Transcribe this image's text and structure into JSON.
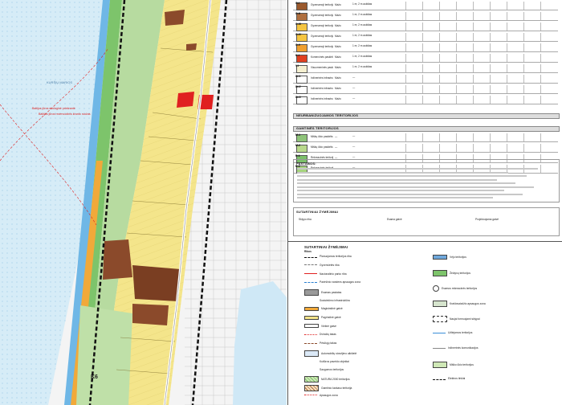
{
  "map": {
    "sea_label": "KURŠIŲ MARIOS",
    "shore_note_1": "Baltijos jūros ekologinė priekrantė",
    "shore_note_2": "Baltijos jūros rezervuotinis kranto ruožas",
    "zone_label": "K6",
    "colors": {
      "sea": "#d6ecf7",
      "dune_green": "#a9d18e",
      "forest": "#d7ebc3",
      "residential": "#f5e98c",
      "commercial": "#8b4a2b",
      "public": "#e02020",
      "beach": "#e8c46a",
      "orange_strip": "#f1a93a",
      "boundary": "#111111"
    }
  },
  "table": {
    "rows": [
      {
        "code": "G-I",
        "color": "#9b5a2e",
        "c1": "Gyvenamoji teritorija",
        "c2": "Mažo",
        "c3": "1 m; 2 m aukštas"
      },
      {
        "code": "G-II",
        "color": "#b07040",
        "c1": "Gyvenamoji teritorija",
        "c2": "Mažo",
        "c3": "1 m; 2 m aukštas"
      },
      {
        "code": "G-III",
        "color": "#f5c542",
        "c1": "Gyvenamoji teritorija",
        "c2": "Mažo",
        "c3": "1 m; 2 m aukštas"
      },
      {
        "code": "G-IV",
        "color": "#f5c542",
        "c1": "Gyvenamoji teritorija",
        "c2": "Mažo",
        "c3": "1 m; 2 m aukštas"
      },
      {
        "code": "G-V",
        "color": "#f0a030",
        "c1": "Gyvenamoji teritorija",
        "c2": "Mažo",
        "c3": "1 m; 2 m aukštas"
      },
      {
        "code": "K-I",
        "color": "#e04020",
        "c1": "Komercinės paskirties",
        "c2": "Mažo",
        "c3": "1 m; 2 m aukštas"
      },
      {
        "code": "V-I",
        "color": "#f5f0d0",
        "c1": "Visuomeninės paskirties",
        "c2": "Mažo",
        "c3": "1 m; 2 m aukštas"
      },
      {
        "code": "IN-1",
        "color": "#ffffff",
        "c1": "Inžinerinės infrastruktūros",
        "c2": "Mažo",
        "c3": "—"
      },
      {
        "code": "IN-2",
        "color": "#ffffff",
        "c1": "Inžinerinės infrastruktūros",
        "c2": "Mažo",
        "c3": "—"
      },
      {
        "code": "IN-3",
        "color": "#ffffff",
        "c1": "Inžinerinės infrastruktūros",
        "c2": "Mažo",
        "c3": "—"
      }
    ],
    "section_2": "NEURBANIZUOJAMOS TERITORIJOS",
    "section_3": "GAMTINĖS TERITORIJOS",
    "rows2": [
      {
        "code": "M-1",
        "color": "#8fc47a",
        "c1": "Miškų ūkio paskirtis",
        "c2": "—",
        "c3": "—"
      },
      {
        "code": "M-2",
        "color": "#b9d98c",
        "c1": "Miškų ūkio paskirtis",
        "c2": "—",
        "c3": "—"
      },
      {
        "code": "R-1",
        "color": "#7cc06a",
        "c1": "Rekreacinės teritorijos",
        "c2": "—",
        "c3": "—"
      },
      {
        "code": "R-2",
        "color": "#a6d47e",
        "c1": "Rekreacinės teritorijos",
        "c2": "—",
        "c3": "—"
      }
    ],
    "notes_title": "PASTABOS:"
  },
  "legend_small": {
    "title": "SUTARTINIAI ŽYMĖJIMAI",
    "items": [
      "Sklypo riba",
      "Esama gatvė",
      "Projektuojama gatvė"
    ]
  },
  "legend": {
    "title": "SUTARTINIAI ŽYMĖJIMAI",
    "subtitle": "Ribos",
    "left_items": [
      {
        "label": "Planuojamos teritorijos riba",
        "sym": "dash-black"
      },
      {
        "label": "Gyvenvietės riba",
        "sym": "dash-gray"
      },
      {
        "label": "Nacionalinio parko riba",
        "sym": "line-red"
      },
      {
        "label": "Paviršinio vandens apsaugos zona",
        "sym": "dash-blue"
      },
      {
        "label": "Esamas pastatas",
        "sym": "fill-gray"
      },
      {
        "label": "Susisiekimo infrastruktūra",
        "sym": "none"
      },
      {
        "label": "Magistralinė gatvė",
        "sym": "line-orange"
      },
      {
        "label": "Pagrindinė gatvė",
        "sym": "line-yellow"
      },
      {
        "label": "Vietinė gatvė",
        "sym": "line-white"
      },
      {
        "label": "Dviračių takas",
        "sym": "dash-red"
      },
      {
        "label": "Pėsčiųjų takas",
        "sym": "dash-brown"
      },
      {
        "label": "Automobilių stovėjimo aikštelė",
        "sym": "box-p"
      },
      {
        "label": "Kultūros paveldo objektai",
        "sym": "none"
      },
      {
        "label": "Saugomos teritorijos",
        "sym": "none"
      },
      {
        "label": "NATURA 2000 teritorijos",
        "sym": "hatch-green"
      },
      {
        "label": "Gamtinio karkaso teritorija",
        "sym": "hatch-brown"
      },
      {
        "label": "Apsaugos zona",
        "sym": "dash-red"
      }
    ],
    "right_items": [
      {
        "label": "Vėjo teritorijos",
        "sym": "box-blue"
      },
      {
        "label": "Želdynų teritorijos",
        "sym": "fill-green"
      },
      {
        "label": "Esamos rekreacinės teritorijos",
        "sym": "circle"
      },
      {
        "label": "Kraštovaizdžio apsaugos zona",
        "sym": "dots"
      },
      {
        "label": "Naujai formuojami sklypai",
        "sym": "box-dash"
      },
      {
        "label": "Užliejamos teritorijos",
        "sym": "line-blue"
      },
      {
        "label": "Inžinerinės komunikacijos",
        "sym": "line-gray"
      },
      {
        "label": "Miško ūkio teritorijos",
        "sym": "fill-lightgreen"
      },
      {
        "label": "Elektros tinklai",
        "sym": "dash-black"
      }
    ]
  }
}
